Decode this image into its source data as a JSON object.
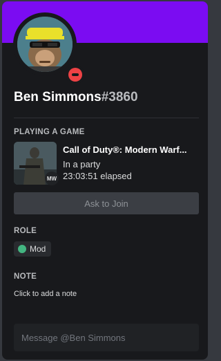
{
  "profile": {
    "username": "Ben Simmons",
    "discriminator": "#3860",
    "status": "do-not-disturb",
    "banner_color": "#7b0cf2"
  },
  "activity": {
    "heading": "PLAYING A GAME",
    "game_title": "Call of Duty®: Modern Warf...",
    "state": "In a party",
    "elapsed": "23:03:51 elapsed",
    "small_icon_text": "MW",
    "join_label": "Ask to Join"
  },
  "roles": {
    "heading": "ROLE",
    "items": [
      {
        "name": "Mod",
        "color": "#43b581"
      }
    ]
  },
  "note": {
    "heading": "NOTE",
    "placeholder": "Click to add a note"
  },
  "message": {
    "placeholder": "Message @Ben Simmons"
  }
}
